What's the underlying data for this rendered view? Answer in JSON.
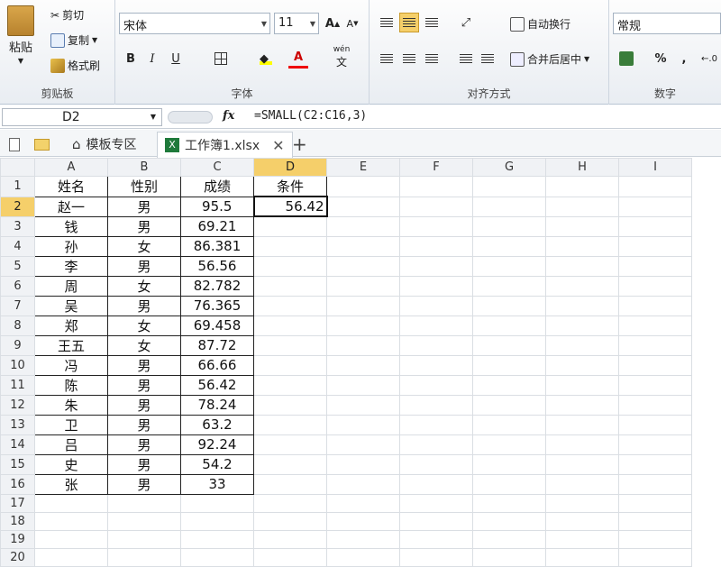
{
  "ribbon": {
    "clipboard": {
      "paste": "粘贴",
      "cut": "剪切",
      "copy": "复制",
      "format_painter": "格式刷",
      "label": "剪贴板"
    },
    "font": {
      "name": "宋体",
      "size": "11",
      "label": "字体",
      "bold": "B",
      "italic": "I",
      "underline": "U",
      "wen": "wén"
    },
    "align": {
      "wrap": "自动换行",
      "merge": "合并后居中",
      "label": "对齐方式"
    },
    "number": {
      "format": "常规",
      "percent": "%",
      "comma": ",",
      "label": "数字"
    }
  },
  "formula_bar": {
    "cell_ref": "D2",
    "fx": "fx",
    "formula": "=SMALL(C2:C16,3)"
  },
  "tabs": [
    {
      "label": "模板专区"
    },
    {
      "label": "工作簿1.xlsx"
    }
  ],
  "columns": [
    "A",
    "B",
    "C",
    "D",
    "E",
    "F",
    "G",
    "H",
    "I"
  ],
  "rows": [
    "1",
    "2",
    "3",
    "4",
    "5",
    "6",
    "7",
    "8",
    "9",
    "10",
    "11",
    "12",
    "13",
    "14",
    "15",
    "16",
    "17",
    "18",
    "19",
    "20"
  ],
  "sheet": [
    [
      "姓名",
      "性别",
      "成绩",
      "条件"
    ],
    [
      "赵一",
      "男",
      "95.5",
      "56.42"
    ],
    [
      "钱",
      "男",
      "69.21",
      ""
    ],
    [
      "孙",
      "女",
      "86.381",
      ""
    ],
    [
      "李",
      "男",
      "56.56",
      ""
    ],
    [
      "周",
      "女",
      "82.782",
      ""
    ],
    [
      "吴",
      "男",
      "76.365",
      ""
    ],
    [
      "郑",
      "女",
      "69.458",
      ""
    ],
    [
      "王五",
      "女",
      "87.72",
      ""
    ],
    [
      "冯",
      "男",
      "66.66",
      ""
    ],
    [
      "陈",
      "男",
      "56.42",
      ""
    ],
    [
      "朱",
      "男",
      "78.24",
      ""
    ],
    [
      "卫",
      "男",
      "63.2",
      ""
    ],
    [
      "吕",
      "男",
      "92.24",
      ""
    ],
    [
      "史",
      "男",
      "54.2",
      ""
    ],
    [
      "张",
      "男",
      "33",
      ""
    ]
  ],
  "colors": {
    "accent": "#f5cf6a",
    "grid": "#dadee3"
  }
}
